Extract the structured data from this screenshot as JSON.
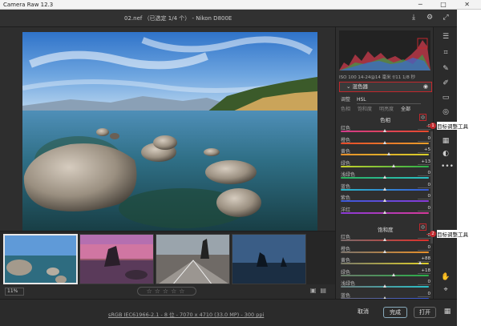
{
  "window": {
    "title": "Camera Raw 12.3",
    "controls": "─ □ ✕"
  },
  "toolbar": {
    "filename": "02.nef （已选定 1/4 个） -  Nikon D800E"
  },
  "histogram": {
    "exif": "ISO 100   14-24@14 毫米   f/11  1/8 秒"
  },
  "panel": {
    "section_title": "混色器",
    "adjust_label": "调整",
    "adjust_value": "HSL",
    "subtabs": [
      "色相",
      "饱和度",
      "明亮度",
      "全部"
    ],
    "active_subtab": 3,
    "hue_group": {
      "title": "色相",
      "sliders": [
        {
          "label": "红色",
          "value": "0",
          "pos": 0.5
        },
        {
          "label": "橙色",
          "value": "0",
          "pos": 0.5
        },
        {
          "label": "黄色",
          "value": "+5",
          "pos": 0.55
        },
        {
          "label": "绿色",
          "value": "+13",
          "pos": 0.6
        },
        {
          "label": "浅绿色",
          "value": "0",
          "pos": 0.5
        },
        {
          "label": "蓝色",
          "value": "0",
          "pos": 0.5
        },
        {
          "label": "紫色",
          "value": "0",
          "pos": 0.5
        },
        {
          "label": "洋红",
          "value": "0",
          "pos": 0.5
        }
      ]
    },
    "sat_group": {
      "title": "饱和度",
      "sliders": [
        {
          "label": "红色",
          "value": "0",
          "pos": 0.5
        },
        {
          "label": "橙色",
          "value": "0",
          "pos": 0.5
        },
        {
          "label": "黄色",
          "value": "+88",
          "pos": 0.9
        },
        {
          "label": "绿色",
          "value": "+18",
          "pos": 0.6
        },
        {
          "label": "浅绿色",
          "value": "0",
          "pos": 0.5
        },
        {
          "label": "蓝色",
          "value": "0",
          "pos": 0.5
        }
      ]
    }
  },
  "callouts": [
    {
      "num": "1",
      "text": "目标调整工具"
    },
    {
      "num": "2",
      "text": "目标调整工具"
    }
  ],
  "statusbar": {
    "zoom": "11%",
    "stars": "☆☆☆☆☆"
  },
  "footer": {
    "meta": "sRGB IEC61966-2.1 - 8 位 - 7070 x 4710 (33.0 MP) - 300 ppi",
    "cancel": "取消",
    "done": "完成",
    "open": "打开"
  },
  "colors": {
    "accent_red": "#c0282d"
  }
}
